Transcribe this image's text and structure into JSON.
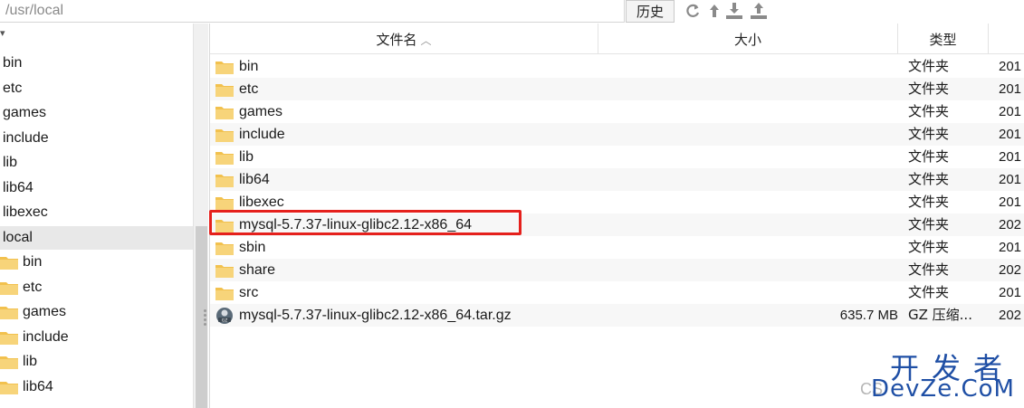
{
  "path_bar": {
    "path_value": "/usr/local",
    "history_label": "历史",
    "tools": [
      "refresh-icon",
      "upload-arrow-icon",
      "download-icon",
      "upload-icon"
    ]
  },
  "tree": {
    "items": [
      {
        "label": "bin",
        "indent": 0,
        "folder": false,
        "selected": false
      },
      {
        "label": "etc",
        "indent": 0,
        "folder": false,
        "selected": false
      },
      {
        "label": "games",
        "indent": 0,
        "folder": false,
        "selected": false
      },
      {
        "label": "include",
        "indent": 0,
        "folder": false,
        "selected": false
      },
      {
        "label": "lib",
        "indent": 0,
        "folder": false,
        "selected": false
      },
      {
        "label": "lib64",
        "indent": 0,
        "folder": false,
        "selected": false
      },
      {
        "label": "libexec",
        "indent": 0,
        "folder": false,
        "selected": false
      },
      {
        "label": "local",
        "indent": 0,
        "folder": false,
        "selected": true
      },
      {
        "label": "bin",
        "indent": 1,
        "folder": true,
        "selected": false
      },
      {
        "label": "etc",
        "indent": 1,
        "folder": true,
        "selected": false
      },
      {
        "label": "games",
        "indent": 1,
        "folder": true,
        "selected": false
      },
      {
        "label": "include",
        "indent": 1,
        "folder": true,
        "selected": false
      },
      {
        "label": "lib",
        "indent": 1,
        "folder": true,
        "selected": false
      },
      {
        "label": "lib64",
        "indent": 1,
        "folder": true,
        "selected": false
      }
    ]
  },
  "file_list": {
    "columns": {
      "name": "文件名",
      "size": "大小",
      "type": "类型"
    },
    "rows": [
      {
        "name": "bin",
        "size": "",
        "type": "文件夹",
        "date": "201",
        "kind": "folder"
      },
      {
        "name": "etc",
        "size": "",
        "type": "文件夹",
        "date": "201",
        "kind": "folder"
      },
      {
        "name": "games",
        "size": "",
        "type": "文件夹",
        "date": "201",
        "kind": "folder"
      },
      {
        "name": "include",
        "size": "",
        "type": "文件夹",
        "date": "201",
        "kind": "folder"
      },
      {
        "name": "lib",
        "size": "",
        "type": "文件夹",
        "date": "201",
        "kind": "folder"
      },
      {
        "name": "lib64",
        "size": "",
        "type": "文件夹",
        "date": "201",
        "kind": "folder"
      },
      {
        "name": "libexec",
        "size": "",
        "type": "文件夹",
        "date": "201",
        "kind": "folder"
      },
      {
        "name": "mysql-5.7.37-linux-glibc2.12-x86_64",
        "size": "",
        "type": "文件夹",
        "date": "202",
        "kind": "folder",
        "highlighted": true
      },
      {
        "name": "sbin",
        "size": "",
        "type": "文件夹",
        "date": "201",
        "kind": "folder"
      },
      {
        "name": "share",
        "size": "",
        "type": "文件夹",
        "date": "202",
        "kind": "folder"
      },
      {
        "name": "src",
        "size": "",
        "type": "文件夹",
        "date": "201",
        "kind": "folder"
      },
      {
        "name": "mysql-5.7.37-linux-glibc2.12-x86_64.tar.gz",
        "size": "635.7 MB",
        "type": "GZ 压缩...",
        "date": "202",
        "kind": "archive"
      }
    ]
  },
  "colors": {
    "folder": "#f2c14e",
    "highlight": "#e5201c",
    "watermark": "#1f4fa5"
  },
  "watermark": {
    "big": "开发者",
    "small": "DevZe.CoM",
    "csdn": "CS"
  }
}
